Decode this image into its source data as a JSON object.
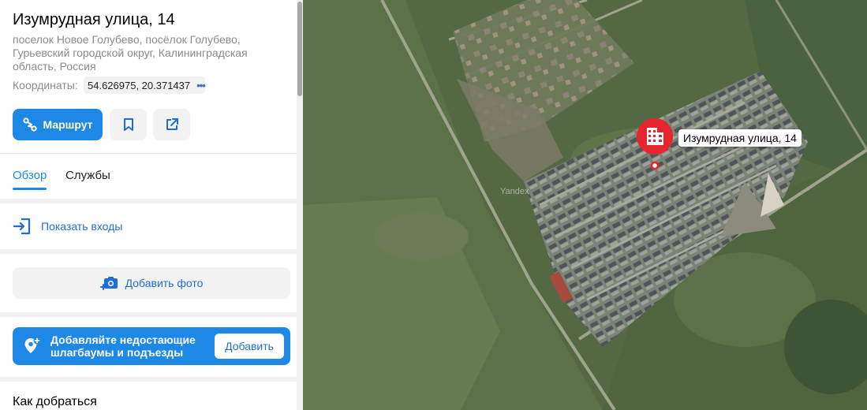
{
  "place": {
    "title": "Изумрудная улица, 14",
    "address_lines": [
      "поселок Новое Голубево, посёлок Голубево,",
      "Гурьевский городской округ, Калининградская",
      "область, Россия"
    ],
    "coords_label": "Координаты:",
    "coords_value": "54.626975, 20.371437",
    "coords_more": "•••"
  },
  "actions": {
    "route_label": "Маршрут",
    "bookmark_icon": "bookmark-icon",
    "share_icon": "share-icon"
  },
  "tabs": [
    {
      "label": "Обзор",
      "active": true
    },
    {
      "label": "Службы",
      "active": false
    }
  ],
  "entrances": {
    "label": "Показать входы"
  },
  "add_photo": {
    "label": "Добавить фото"
  },
  "promo": {
    "line1": "Добавляйте недостающие",
    "line2": "шлагбаумы и подъезды",
    "button": "Добавить"
  },
  "how_to_get": {
    "title": "Как добраться"
  },
  "map": {
    "marker_label": "Изумрудная улица, 14",
    "watermark": "Yandex"
  },
  "colors": {
    "accent": "#1e88e5",
    "marker": "#e8242c"
  }
}
